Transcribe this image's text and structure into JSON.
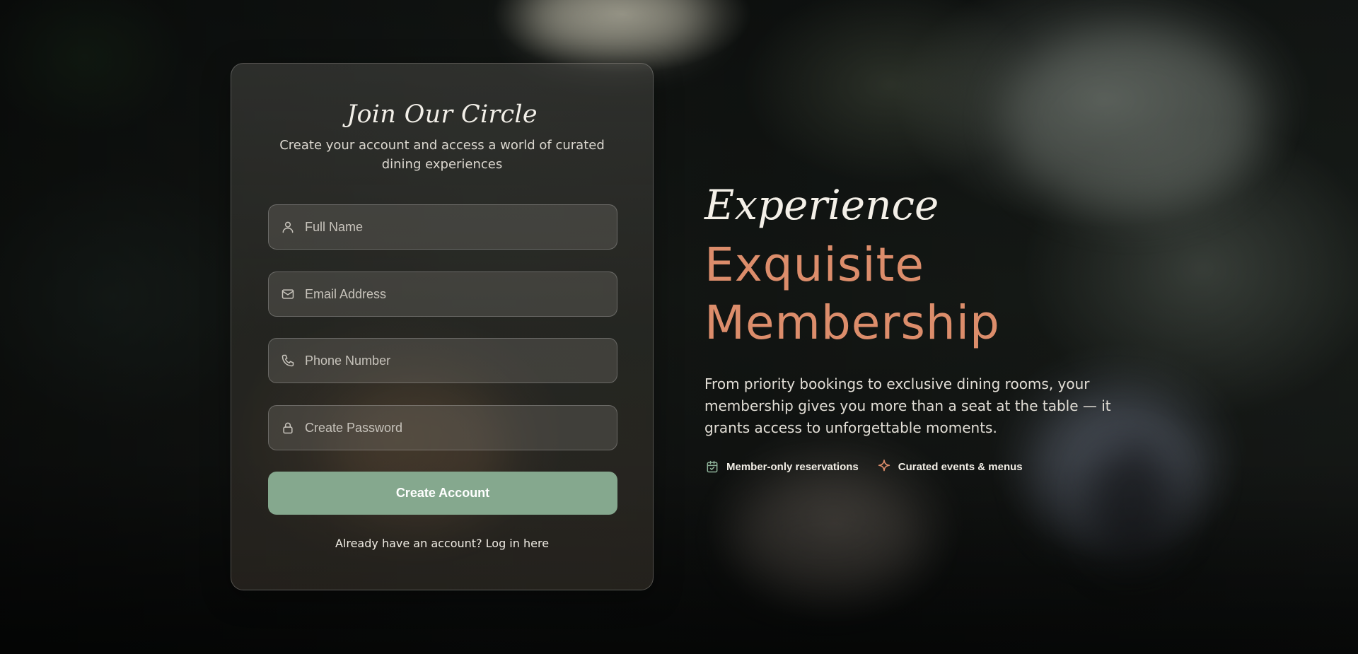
{
  "signup": {
    "title": "Join Our Circle",
    "subtitle": "Create your account and access a world of curated dining experiences",
    "fields": [
      {
        "icon": "user-icon",
        "placeholder": "Full Name",
        "value": ""
      },
      {
        "icon": "mail-icon",
        "placeholder": "Email Address",
        "value": ""
      },
      {
        "icon": "phone-icon",
        "placeholder": "Phone Number",
        "value": ""
      },
      {
        "icon": "lock-icon",
        "placeholder": "Create Password",
        "value": ""
      }
    ],
    "submit_label": "Create Account",
    "login_link": "Already have an account? Log in here"
  },
  "hero": {
    "eyebrow": "Experience",
    "title_line1": "Exquisite",
    "title_line2": "Membership",
    "description": "From priority bookings to exclusive dining rooms, your membership gives you more than a seat at the table — it grants access to unforgettable moments.",
    "perks": [
      {
        "icon": "calendar-check-icon",
        "label": "Member-only reservations"
      },
      {
        "icon": "sparkle-icon",
        "label": "Curated events & menus"
      }
    ]
  },
  "colors": {
    "accent": "#dc8d6b",
    "button": "#85a88e",
    "perk_icon_green": "#8fb39a",
    "perk_icon_orange": "#dc8d6b"
  }
}
